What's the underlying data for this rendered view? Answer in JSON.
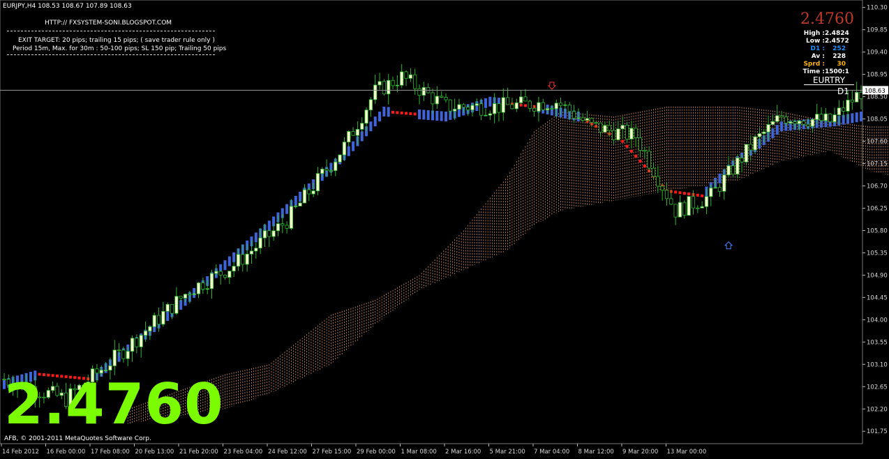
{
  "header": {
    "symbol_line": "EURJPY,H4  108.53 108.67 107.89 108.63",
    "url": "HTTP:// FXSYSTEM-SONI.BLOGSPOT.COM",
    "exit_target": "EXIT TARGET: 20 pips; trailing 15 pips; ( save trader rule only )",
    "period_line": "Period 15m, Max. for 30m  : 50-100 pips; SL 150 pip; Trailing 50 pips"
  },
  "panel": {
    "price": "2.4760",
    "stats": [
      {
        "key": "High :",
        "value": "2.4824",
        "color": "#ffffff"
      },
      {
        "key": "Low :",
        "value": "2.4572",
        "color": "#ffffff"
      },
      {
        "key": "D1 :",
        "value": "252",
        "color": "#1e90ff"
      },
      {
        "key": "Av :",
        "value": "228",
        "color": "#ffffff"
      },
      {
        "key": "Sprd :",
        "value": "30",
        "color": "#ffb400"
      },
      {
        "key": "Time :",
        "value": "1500:1",
        "color": "#ffffff"
      }
    ],
    "pair": "EURTRY",
    "timeframe": "D1"
  },
  "big_price": "2.4760",
  "copyright": "AFB, © 2001-2011 MetaQuotes Software Corp.",
  "current_price_label": "108.63",
  "colors": {
    "background": "#000000",
    "bull_candle": "#2db82d",
    "bull_body": "#f5ffcc",
    "blue_line": "#3f64d8",
    "red_line": "#ff1a1a",
    "cloud": "#d9956a",
    "axis": "#bbbbbb",
    "big_price": "#7cfc00"
  },
  "chart_data": {
    "type": "candlestick",
    "symbol": "EURJPY",
    "timeframe": "H4",
    "ylim": [
      101.5,
      110.45
    ],
    "y_ticks": [
      "110.30",
      "109.85",
      "109.40",
      "108.95",
      "108.50",
      "108.05",
      "107.60",
      "107.15",
      "106.70",
      "106.25",
      "105.80",
      "105.35",
      "104.90",
      "104.45",
      "104.00",
      "103.55",
      "103.10",
      "102.65",
      "102.20",
      "101.75"
    ],
    "x_ticks": [
      "14 Feb 2012",
      "16 Feb 00:00",
      "17 Feb 08:00",
      "20 Feb 13:00",
      "21 Feb 20:00",
      "23 Feb 04:00",
      "24 Feb 12:00",
      "27 Feb 15:00",
      "29 Feb 00:00",
      "1 Mar 08:00",
      "2 Mar 16:00",
      "5 Mar 21:00",
      "7 Mar 04:00",
      "8 Mar 12:00",
      "9 Mar 20:00",
      "13 Mar 00:00"
    ],
    "price_key_points": [
      [
        0,
        102.8
      ],
      [
        14,
        102.4
      ],
      [
        26,
        103.3
      ],
      [
        42,
        104.6
      ],
      [
        52,
        105.1
      ],
      [
        64,
        106.0
      ],
      [
        77,
        107.5
      ],
      [
        84,
        108.6
      ],
      [
        90,
        108.9
      ],
      [
        100,
        108.3
      ],
      [
        112,
        108.3
      ],
      [
        125,
        108.4
      ],
      [
        133,
        107.9
      ],
      [
        143,
        107.7
      ],
      [
        152,
        106.2
      ],
      [
        160,
        106.5
      ],
      [
        170,
        107.6
      ],
      [
        176,
        108.1
      ],
      [
        187,
        108.0
      ],
      [
        194,
        108.6
      ]
    ],
    "signal_line_key_points": [
      [
        0,
        102.7
      ],
      [
        8,
        102.9
      ],
      [
        20,
        102.8
      ],
      [
        40,
        104.3
      ],
      [
        60,
        105.9
      ],
      [
        78,
        107.4
      ],
      [
        86,
        108.2
      ],
      [
        100,
        108.1
      ],
      [
        110,
        108.4
      ],
      [
        120,
        108.3
      ],
      [
        130,
        108.1
      ],
      [
        140,
        107.6
      ],
      [
        150,
        106.6
      ],
      [
        158,
        106.5
      ],
      [
        166,
        107.2
      ],
      [
        176,
        107.9
      ],
      [
        188,
        108.0
      ],
      [
        194,
        108.1
      ]
    ],
    "red_segments": [
      [
        8,
        20
      ],
      [
        88,
        93
      ],
      [
        113,
        120
      ],
      [
        131,
        158
      ]
    ],
    "cloud_top_key_points": [
      [
        28,
        102.2
      ],
      [
        50,
        102.9
      ],
      [
        60,
        103.1
      ],
      [
        74,
        104.1
      ],
      [
        84,
        104.4
      ],
      [
        94,
        104.9
      ],
      [
        104,
        105.8
      ],
      [
        114,
        106.9
      ],
      [
        120,
        107.8
      ],
      [
        126,
        108.2
      ],
      [
        138,
        108.1
      ],
      [
        150,
        108.3
      ],
      [
        166,
        108.3
      ],
      [
        176,
        108.2
      ],
      [
        187,
        108.0
      ],
      [
        196,
        107.9
      ],
      [
        206,
        107.9
      ],
      [
        212,
        107.4
      ],
      [
        222,
        107.6
      ],
      [
        232,
        107.6
      ]
    ],
    "cloud_bottom_key_points": [
      [
        28,
        101.9
      ],
      [
        50,
        102.2
      ],
      [
        60,
        102.5
      ],
      [
        74,
        103.1
      ],
      [
        84,
        103.9
      ],
      [
        94,
        104.6
      ],
      [
        104,
        105.0
      ],
      [
        114,
        105.4
      ],
      [
        120,
        105.9
      ],
      [
        126,
        106.2
      ],
      [
        138,
        106.4
      ],
      [
        150,
        106.6
      ],
      [
        166,
        106.8
      ],
      [
        176,
        107.2
      ],
      [
        187,
        107.4
      ],
      [
        196,
        107.0
      ],
      [
        206,
        106.8
      ],
      [
        212,
        106.9
      ],
      [
        222,
        107.1
      ],
      [
        232,
        107.2
      ]
    ],
    "arrows": [
      {
        "bar": 124,
        "price": 108.72,
        "direction": "down"
      },
      {
        "bar": 164,
        "price": 105.5,
        "direction": "up"
      }
    ],
    "current_price": 108.63
  }
}
